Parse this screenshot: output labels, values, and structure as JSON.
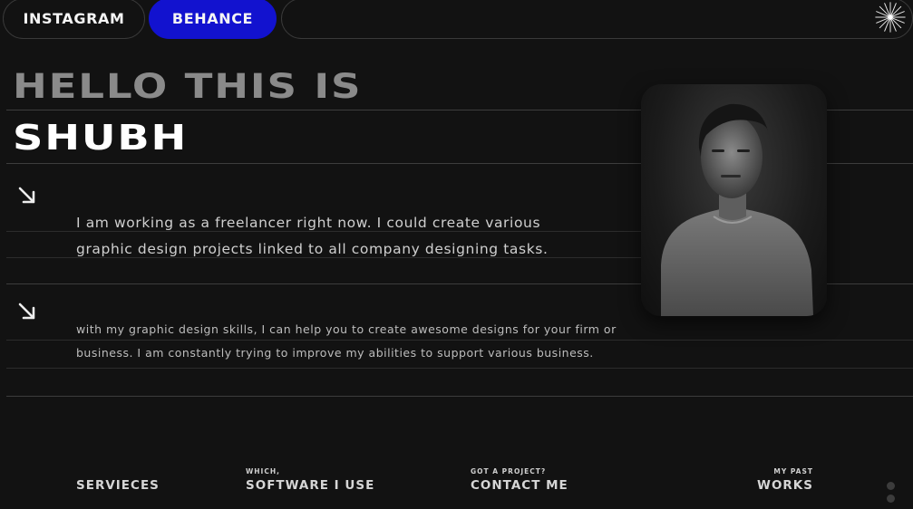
{
  "nav": {
    "instagram": "INSTAGRAM",
    "behance": "BEHANCE",
    "accent": "#1212cf"
  },
  "hero": {
    "greeting": "HELLO THIS IS",
    "name": "SHUBH"
  },
  "intro": {
    "para1": "I am working as a freelancer right now. I could create various graphic design projects linked to all company designing tasks.",
    "para2": "with my graphic design skills, I can help you to create awesome designs for your firm or business. I am constantly trying to improve my abilities to support various business."
  },
  "footer": {
    "services": {
      "label": "SERVIECES"
    },
    "software": {
      "kicker": "WHICH,",
      "label": "SOFTWARE I USE"
    },
    "contact": {
      "kicker": "GOT A PROJECT?",
      "label": "CONTACT ME"
    },
    "works": {
      "kicker": "MY PAST",
      "label": "WORKS"
    }
  },
  "icons": {
    "spark": "sparkle-icon",
    "arrow": "arrow-down-right-icon"
  }
}
